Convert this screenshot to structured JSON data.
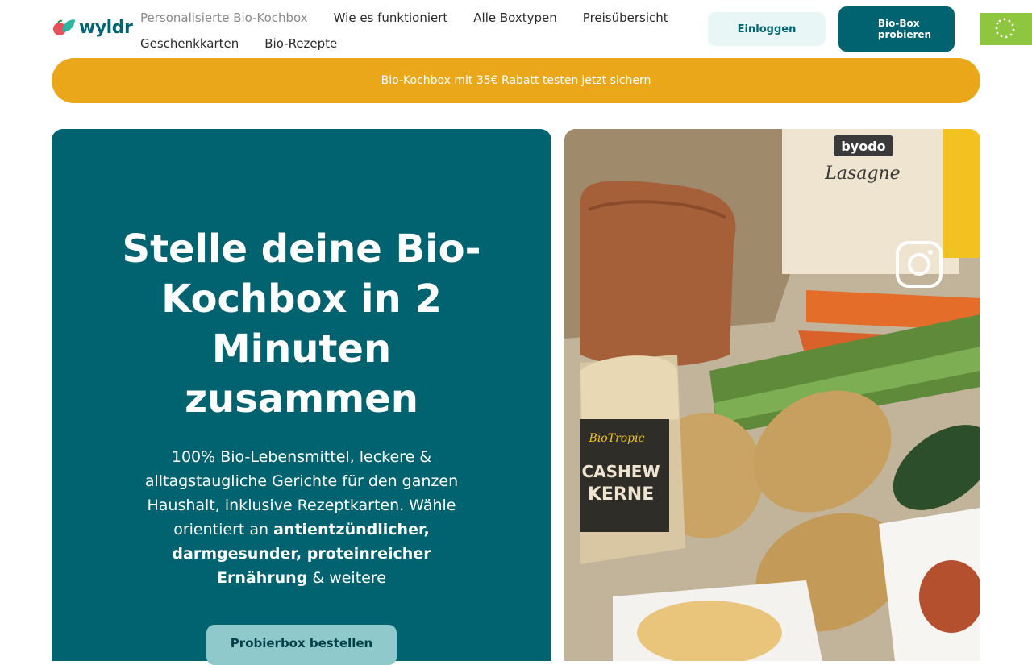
{
  "brand": {
    "name": "wyldr"
  },
  "nav": {
    "items": [
      {
        "label": "Personalisierte Bio-Kochbox",
        "active": true
      },
      {
        "label": "Wie es funktioniert"
      },
      {
        "label": "Alle Boxtypen"
      },
      {
        "label": "Preisübersicht"
      },
      {
        "label": "Geschenkkarten"
      },
      {
        "label": "Bio-Rezepte"
      }
    ]
  },
  "header": {
    "login_label": "Einloggen",
    "try_label_line1": "Bio-Box",
    "try_label_line2": "probieren"
  },
  "promo": {
    "text": "Bio-Kochbox mit 35€ Rabatt testen",
    "link": "jetzt sichern"
  },
  "hero": {
    "title": "Stelle deine Bio-Kochbox in 2 Minuten zusammen",
    "desc_1": "100% Bio-Lebensmittel, leckere & alltagstaugliche Gerichte für den ganzen Haushalt, inklusive Rezeptkarten. Wähle orientiert an ",
    "desc_bold": "antientzündlicher, darmgesunder, proteinreicher Ernährung",
    "desc_2": " & weitere",
    "cta_label": "Probierbox bestellen"
  },
  "image": {
    "product_labels": [
      "byodo",
      "Lasagne",
      "BioTropic",
      "CASHEW",
      "KERNE"
    ]
  },
  "colors": {
    "primary": "#00636f",
    "promo": "#eaa71a",
    "login_bg": "#e8f6f6",
    "cta_bg": "#8fc9cc"
  }
}
